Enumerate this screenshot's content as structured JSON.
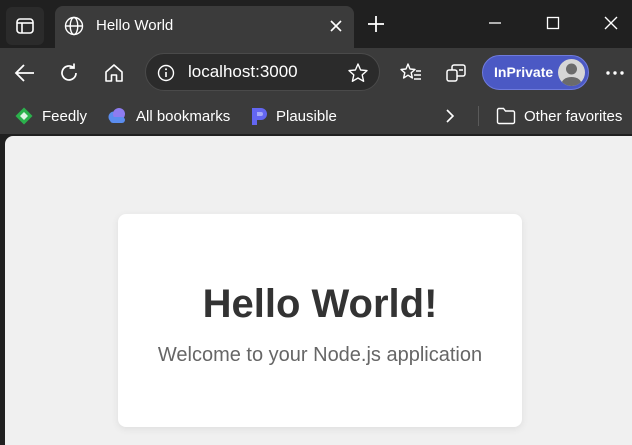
{
  "tab": {
    "title": "Hello World",
    "icon": "globe-icon"
  },
  "address_bar": {
    "url": "localhost:3000"
  },
  "profile": {
    "label": "InPrivate",
    "accent": "#4b59c4"
  },
  "favorites": {
    "items": [
      {
        "label": "Feedly",
        "icon": "feedly-icon",
        "color": "#2bb24c"
      },
      {
        "label": "All bookmarks",
        "icon": "cloud-icon",
        "color": "#5b8def"
      },
      {
        "label": "Plausible",
        "icon": "plausible-icon",
        "color": "#6366f1"
      }
    ],
    "other_label": "Other favorites"
  },
  "page": {
    "heading": "Hello World!",
    "subtitle": "Welcome to your Node.js application",
    "background": "#f0f0f0",
    "heading_color": "#333333",
    "subtitle_color": "#666666"
  },
  "theme": {
    "frame": "#202020",
    "toolbar": "#3b3b3b"
  }
}
